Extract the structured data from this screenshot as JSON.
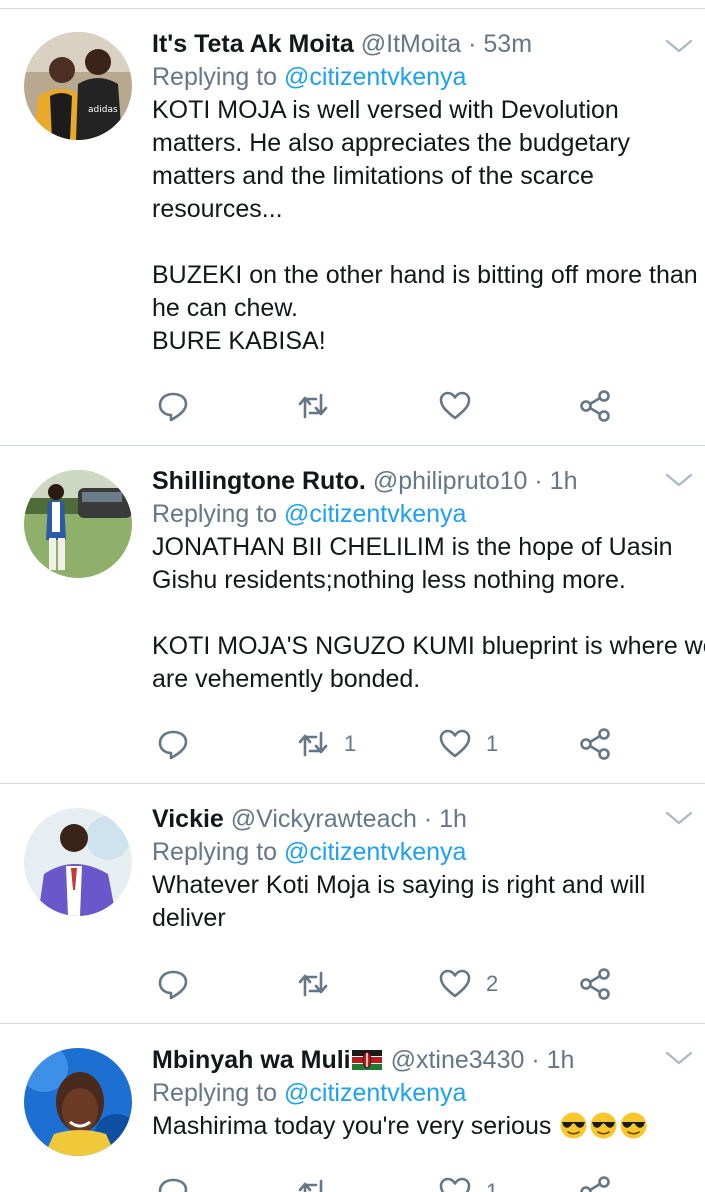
{
  "tweets": [
    {
      "name": "It's Teta Ak Moita",
      "handle": "@ItMoita",
      "time": "· 53m",
      "replying_prefix": "Replying to",
      "replying_handle": "@citizentvkenya",
      "lines": [
        "KOTI MOJA is well versed with Devolution",
        "matters. He also appreciates the budgetary",
        "matters and the limitations of the scarce",
        "resources...",
        "",
        "BUZEKI on the other hand is bitting off more than",
        "he can chew.",
        "BURE KABISA!"
      ],
      "reply_count": "",
      "retweet_count": "",
      "like_count": ""
    },
    {
      "name": "Shillingtone Ruto.",
      "handle": "@philipruto10",
      "time": "· 1h",
      "replying_prefix": "Replying to",
      "replying_handle": "@citizentvkenya",
      "lines": [
        "JONATHAN BII CHELILIM is the hope of Uasin",
        "Gishu residents;nothing less nothing more.",
        "",
        "KOTI MOJA'S NGUZO KUMI blueprint is where we",
        "are vehemently bonded."
      ],
      "reply_count": "",
      "retweet_count": "1",
      "like_count": "1"
    },
    {
      "name": "Vickie",
      "handle": "@Vickyrawteach",
      "time": "· 1h",
      "replying_prefix": "Replying to",
      "replying_handle": "@citizentvkenya",
      "lines": [
        "Whatever Koti Moja is saying is right and will",
        "deliver"
      ],
      "reply_count": "",
      "retweet_count": "",
      "like_count": "2"
    },
    {
      "name": "Mbinyah wa Muli",
      "name_flag": "kenya-flag-emoji",
      "handle": "@xtine3430",
      "time": "· 1h",
      "replying_prefix": "Replying to",
      "replying_handle": "@citizentvkenya",
      "lines": [
        "Mashirima today you're very serious"
      ],
      "trailing_emoji": [
        "sunglasses-emoji",
        "sunglasses-emoji",
        "sunglasses-emoji"
      ],
      "reply_count": "",
      "retweet_count": "",
      "like_count": "1"
    }
  ],
  "colors": {
    "text": "#14171a",
    "secondary": "#657786",
    "link": "#1da1f2",
    "divider": "#d3d8dc",
    "icon": "#657786"
  }
}
